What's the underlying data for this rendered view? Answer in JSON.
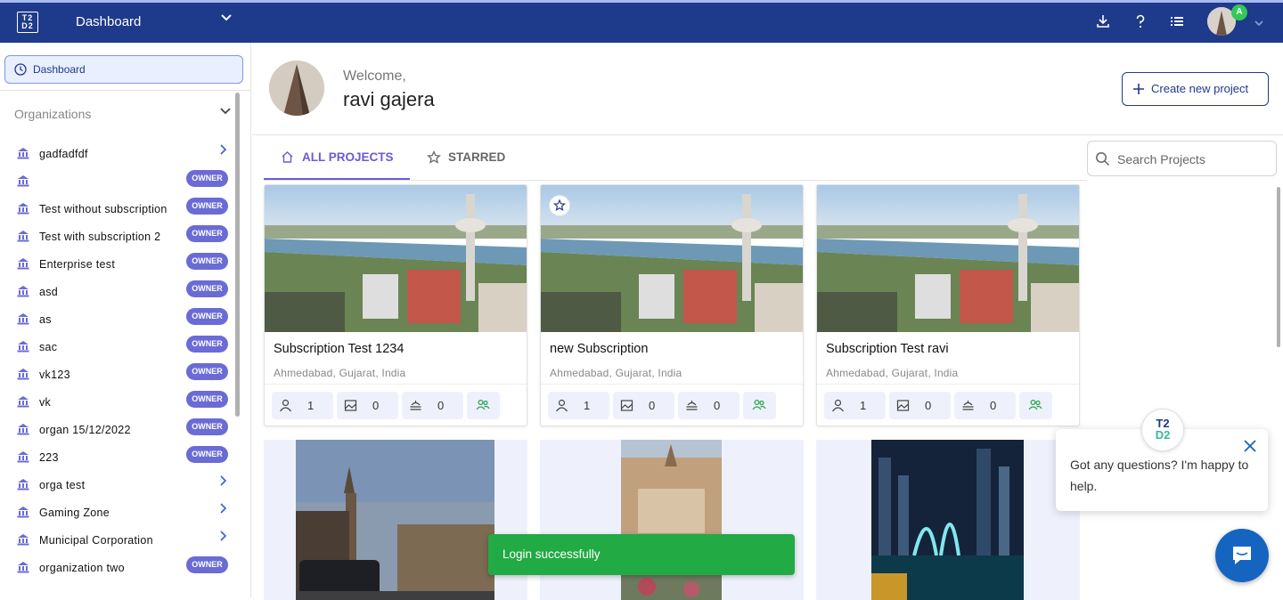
{
  "topbar": {
    "logo_text": "T2D2",
    "app_title": "Dashboard",
    "avatar_badge": "A",
    "icons": [
      "download-icon",
      "help-icon",
      "list-icon",
      "chevron-down-icon"
    ],
    "bar_color": "#1e3a8a"
  },
  "sidebar": {
    "dashboard_label": "Dashboard",
    "organizations_heading": "Organizations",
    "orgs": [
      {
        "name": "gadfadfdf",
        "badge": "",
        "expand": true
      },
      {
        "name": "",
        "badge": "OWNER",
        "expand": false
      },
      {
        "name": "Test without subscription",
        "badge": "OWNER",
        "expand": false
      },
      {
        "name": "Test with subscription 2",
        "badge": "OWNER",
        "expand": false
      },
      {
        "name": "Enterprise test",
        "badge": "OWNER",
        "expand": false
      },
      {
        "name": "asd",
        "badge": "OWNER",
        "expand": false
      },
      {
        "name": "as",
        "badge": "OWNER",
        "expand": false
      },
      {
        "name": "sac",
        "badge": "OWNER",
        "expand": false
      },
      {
        "name": "vk123",
        "badge": "OWNER",
        "expand": false
      },
      {
        "name": "vk",
        "badge": "OWNER",
        "expand": false
      },
      {
        "name": "organ 15/12/2022",
        "badge": "OWNER",
        "expand": false
      },
      {
        "name": "223",
        "badge": "OWNER",
        "expand": false
      },
      {
        "name": "orga test",
        "badge": "",
        "expand": true
      },
      {
        "name": "Gaming Zone",
        "badge": "",
        "expand": true
      },
      {
        "name": "Municipal Corporation",
        "badge": "",
        "expand": true
      },
      {
        "name": "organization two",
        "badge": "OWNER",
        "expand": false
      }
    ],
    "badge_color": "#6b6bd6"
  },
  "welcome": {
    "label": "Welcome,",
    "name": "ravi gajera",
    "create_button": "Create new project"
  },
  "tabs": {
    "all": "ALL PROJECTS",
    "starred": "STARRED",
    "active_color": "#6b5bd6"
  },
  "search": {
    "placeholder": "Search Projects"
  },
  "projects": [
    {
      "title": "Subscription Test 1234",
      "location": "Ahmedabad, Gujarat, India",
      "users": "1",
      "images": "0",
      "assets": "0",
      "starred": false
    },
    {
      "title": "new Subscription",
      "location": "Ahmedabad, Gujarat, India",
      "users": "1",
      "images": "0",
      "assets": "0",
      "starred": true
    },
    {
      "title": "Subscription Test ravi",
      "location": "Ahmedabad, Gujarat, India",
      "users": "1",
      "images": "0",
      "assets": "0",
      "starred": false
    }
  ],
  "toast": {
    "message": "Login successfully",
    "color": "#22aa44"
  },
  "chat": {
    "message": "Got any questions? I'm happy to help.",
    "logo_text": "T2D2"
  }
}
